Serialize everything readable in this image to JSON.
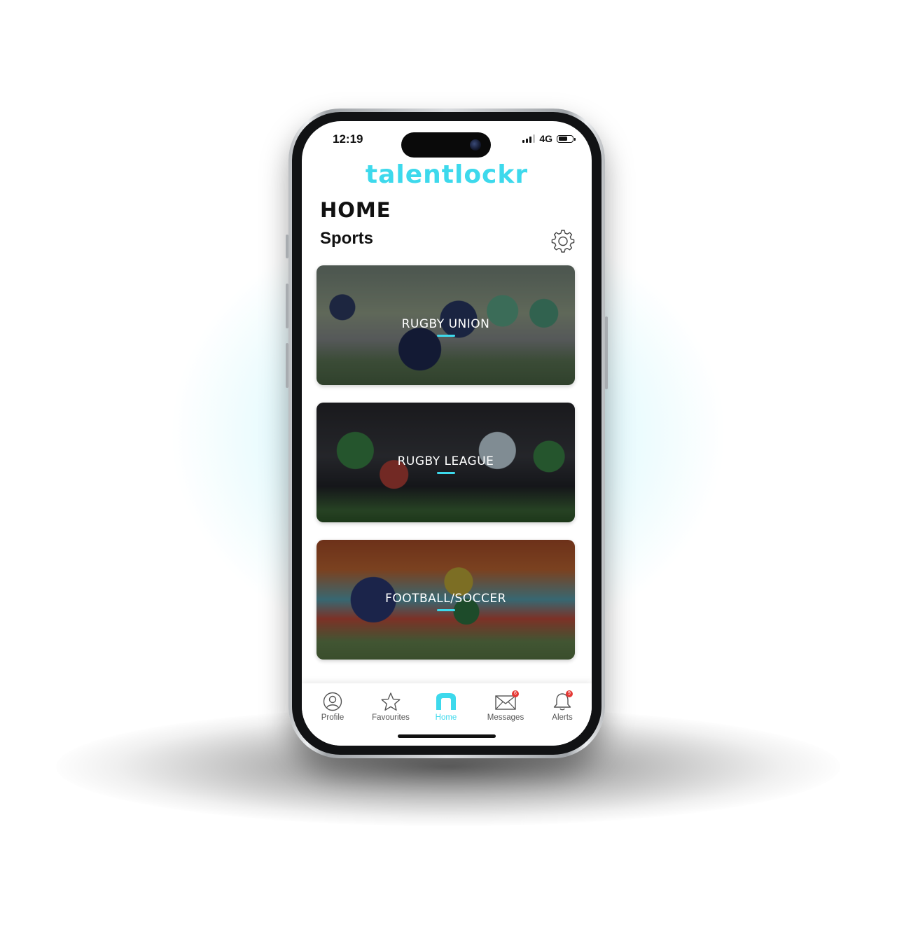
{
  "status_bar": {
    "time": "12:19",
    "network": "4G"
  },
  "app": {
    "logo_text": "talentlockr",
    "brand_color": "#3dd9ec"
  },
  "page": {
    "heading": "HOME",
    "section_title": "Sports"
  },
  "sports": [
    {
      "label": "RUGBY UNION"
    },
    {
      "label": "RUGBY LEAGUE"
    },
    {
      "label": "FOOTBALL/SOCCER"
    }
  ],
  "tabs": [
    {
      "label": "Profile",
      "icon": "profile-icon"
    },
    {
      "label": "Favourites",
      "icon": "star-icon"
    },
    {
      "label": "Home",
      "icon": "home-icon",
      "active": true
    },
    {
      "label": "Messages",
      "icon": "envelope-icon",
      "badge": "6"
    },
    {
      "label": "Alerts",
      "icon": "bell-icon",
      "badge": "9"
    }
  ]
}
